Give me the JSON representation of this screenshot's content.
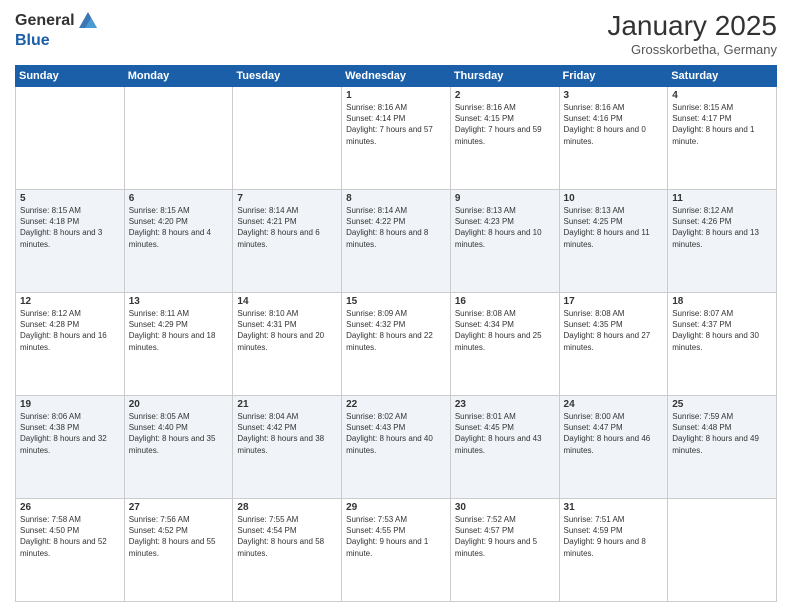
{
  "logo": {
    "general": "General",
    "blue": "Blue"
  },
  "header": {
    "title": "January 2025",
    "subtitle": "Grosskorbetha, Germany"
  },
  "weekdays": [
    "Sunday",
    "Monday",
    "Tuesday",
    "Wednesday",
    "Thursday",
    "Friday",
    "Saturday"
  ],
  "weeks": [
    [
      {
        "day": "",
        "sunrise": "",
        "sunset": "",
        "daylight": ""
      },
      {
        "day": "",
        "sunrise": "",
        "sunset": "",
        "daylight": ""
      },
      {
        "day": "",
        "sunrise": "",
        "sunset": "",
        "daylight": ""
      },
      {
        "day": "1",
        "sunrise": "Sunrise: 8:16 AM",
        "sunset": "Sunset: 4:14 PM",
        "daylight": "Daylight: 7 hours and 57 minutes."
      },
      {
        "day": "2",
        "sunrise": "Sunrise: 8:16 AM",
        "sunset": "Sunset: 4:15 PM",
        "daylight": "Daylight: 7 hours and 59 minutes."
      },
      {
        "day": "3",
        "sunrise": "Sunrise: 8:16 AM",
        "sunset": "Sunset: 4:16 PM",
        "daylight": "Daylight: 8 hours and 0 minutes."
      },
      {
        "day": "4",
        "sunrise": "Sunrise: 8:15 AM",
        "sunset": "Sunset: 4:17 PM",
        "daylight": "Daylight: 8 hours and 1 minute."
      }
    ],
    [
      {
        "day": "5",
        "sunrise": "Sunrise: 8:15 AM",
        "sunset": "Sunset: 4:18 PM",
        "daylight": "Daylight: 8 hours and 3 minutes."
      },
      {
        "day": "6",
        "sunrise": "Sunrise: 8:15 AM",
        "sunset": "Sunset: 4:20 PM",
        "daylight": "Daylight: 8 hours and 4 minutes."
      },
      {
        "day": "7",
        "sunrise": "Sunrise: 8:14 AM",
        "sunset": "Sunset: 4:21 PM",
        "daylight": "Daylight: 8 hours and 6 minutes."
      },
      {
        "day": "8",
        "sunrise": "Sunrise: 8:14 AM",
        "sunset": "Sunset: 4:22 PM",
        "daylight": "Daylight: 8 hours and 8 minutes."
      },
      {
        "day": "9",
        "sunrise": "Sunrise: 8:13 AM",
        "sunset": "Sunset: 4:23 PM",
        "daylight": "Daylight: 8 hours and 10 minutes."
      },
      {
        "day": "10",
        "sunrise": "Sunrise: 8:13 AM",
        "sunset": "Sunset: 4:25 PM",
        "daylight": "Daylight: 8 hours and 11 minutes."
      },
      {
        "day": "11",
        "sunrise": "Sunrise: 8:12 AM",
        "sunset": "Sunset: 4:26 PM",
        "daylight": "Daylight: 8 hours and 13 minutes."
      }
    ],
    [
      {
        "day": "12",
        "sunrise": "Sunrise: 8:12 AM",
        "sunset": "Sunset: 4:28 PM",
        "daylight": "Daylight: 8 hours and 16 minutes."
      },
      {
        "day": "13",
        "sunrise": "Sunrise: 8:11 AM",
        "sunset": "Sunset: 4:29 PM",
        "daylight": "Daylight: 8 hours and 18 minutes."
      },
      {
        "day": "14",
        "sunrise": "Sunrise: 8:10 AM",
        "sunset": "Sunset: 4:31 PM",
        "daylight": "Daylight: 8 hours and 20 minutes."
      },
      {
        "day": "15",
        "sunrise": "Sunrise: 8:09 AM",
        "sunset": "Sunset: 4:32 PM",
        "daylight": "Daylight: 8 hours and 22 minutes."
      },
      {
        "day": "16",
        "sunrise": "Sunrise: 8:08 AM",
        "sunset": "Sunset: 4:34 PM",
        "daylight": "Daylight: 8 hours and 25 minutes."
      },
      {
        "day": "17",
        "sunrise": "Sunrise: 8:08 AM",
        "sunset": "Sunset: 4:35 PM",
        "daylight": "Daylight: 8 hours and 27 minutes."
      },
      {
        "day": "18",
        "sunrise": "Sunrise: 8:07 AM",
        "sunset": "Sunset: 4:37 PM",
        "daylight": "Daylight: 8 hours and 30 minutes."
      }
    ],
    [
      {
        "day": "19",
        "sunrise": "Sunrise: 8:06 AM",
        "sunset": "Sunset: 4:38 PM",
        "daylight": "Daylight: 8 hours and 32 minutes."
      },
      {
        "day": "20",
        "sunrise": "Sunrise: 8:05 AM",
        "sunset": "Sunset: 4:40 PM",
        "daylight": "Daylight: 8 hours and 35 minutes."
      },
      {
        "day": "21",
        "sunrise": "Sunrise: 8:04 AM",
        "sunset": "Sunset: 4:42 PM",
        "daylight": "Daylight: 8 hours and 38 minutes."
      },
      {
        "day": "22",
        "sunrise": "Sunrise: 8:02 AM",
        "sunset": "Sunset: 4:43 PM",
        "daylight": "Daylight: 8 hours and 40 minutes."
      },
      {
        "day": "23",
        "sunrise": "Sunrise: 8:01 AM",
        "sunset": "Sunset: 4:45 PM",
        "daylight": "Daylight: 8 hours and 43 minutes."
      },
      {
        "day": "24",
        "sunrise": "Sunrise: 8:00 AM",
        "sunset": "Sunset: 4:47 PM",
        "daylight": "Daylight: 8 hours and 46 minutes."
      },
      {
        "day": "25",
        "sunrise": "Sunrise: 7:59 AM",
        "sunset": "Sunset: 4:48 PM",
        "daylight": "Daylight: 8 hours and 49 minutes."
      }
    ],
    [
      {
        "day": "26",
        "sunrise": "Sunrise: 7:58 AM",
        "sunset": "Sunset: 4:50 PM",
        "daylight": "Daylight: 8 hours and 52 minutes."
      },
      {
        "day": "27",
        "sunrise": "Sunrise: 7:56 AM",
        "sunset": "Sunset: 4:52 PM",
        "daylight": "Daylight: 8 hours and 55 minutes."
      },
      {
        "day": "28",
        "sunrise": "Sunrise: 7:55 AM",
        "sunset": "Sunset: 4:54 PM",
        "daylight": "Daylight: 8 hours and 58 minutes."
      },
      {
        "day": "29",
        "sunrise": "Sunrise: 7:53 AM",
        "sunset": "Sunset: 4:55 PM",
        "daylight": "Daylight: 9 hours and 1 minute."
      },
      {
        "day": "30",
        "sunrise": "Sunrise: 7:52 AM",
        "sunset": "Sunset: 4:57 PM",
        "daylight": "Daylight: 9 hours and 5 minutes."
      },
      {
        "day": "31",
        "sunrise": "Sunrise: 7:51 AM",
        "sunset": "Sunset: 4:59 PM",
        "daylight": "Daylight: 9 hours and 8 minutes."
      },
      {
        "day": "",
        "sunrise": "",
        "sunset": "",
        "daylight": ""
      }
    ]
  ]
}
